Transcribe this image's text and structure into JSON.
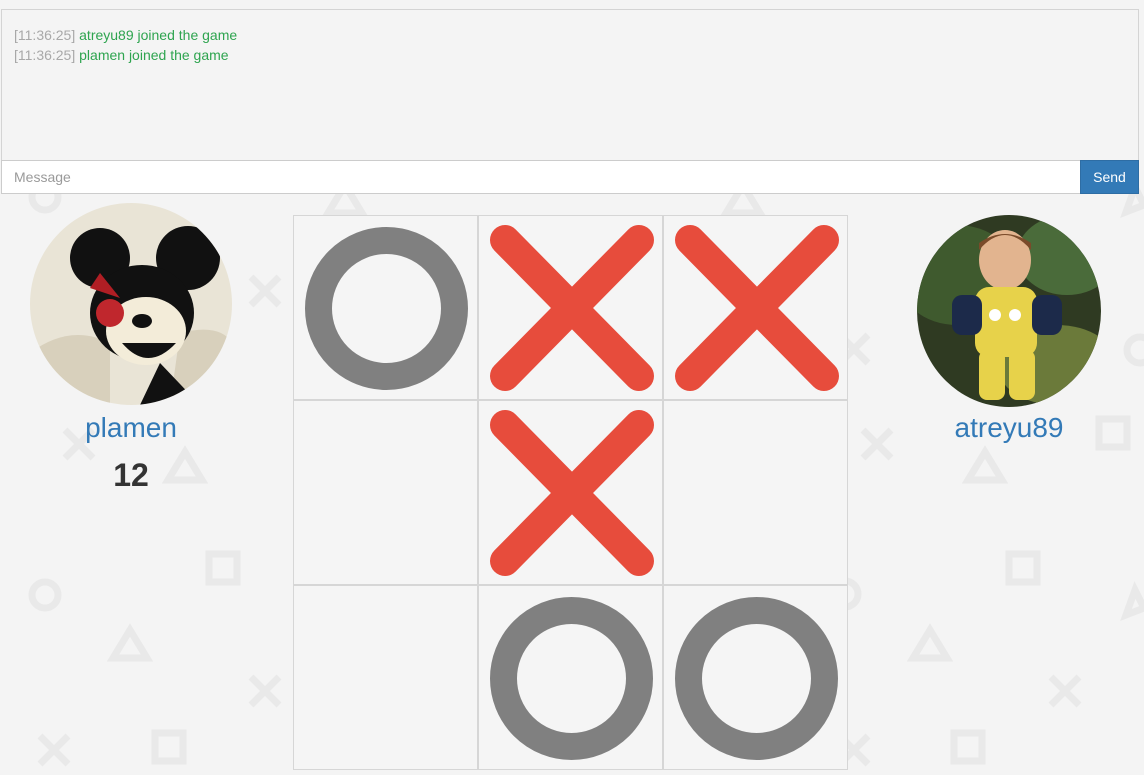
{
  "chat": {
    "messages": [
      {
        "time": "[11:36:25]",
        "text": "atreyu89 joined the game"
      },
      {
        "time": "[11:36:25]",
        "text": "plamen joined the game"
      }
    ],
    "input_placeholder": "Message",
    "send_label": "Send"
  },
  "players": {
    "left": {
      "name": "plamen",
      "score": "12"
    },
    "right": {
      "name": "atreyu89"
    }
  },
  "board": {
    "cells": [
      "O",
      "X",
      "X",
      "",
      "X",
      "",
      "",
      "O",
      "O"
    ]
  },
  "colors": {
    "x_mark": "#e74c3c",
    "o_mark": "#808080",
    "accent": "#337ab7",
    "chat_text": "#2ea44f"
  }
}
